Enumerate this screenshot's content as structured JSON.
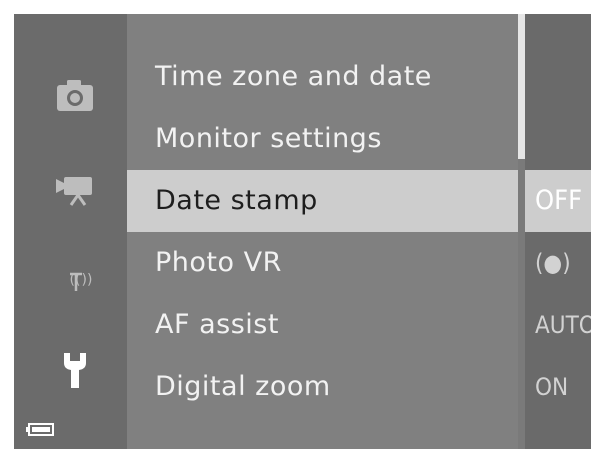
{
  "sidebar": {
    "icons": [
      "camera-icon",
      "movie-camera-icon",
      "wireless-icon",
      "wrench-icon"
    ]
  },
  "menu": {
    "items": [
      {
        "label": "Time zone and date",
        "value": ""
      },
      {
        "label": "Monitor settings",
        "value": ""
      },
      {
        "label": "Date stamp",
        "value": "OFF",
        "selected": true
      },
      {
        "label": "Photo VR",
        "value": "(●)"
      },
      {
        "label": "AF assist",
        "value": "AUTO"
      },
      {
        "label": "Digital zoom",
        "value": "ON"
      }
    ]
  },
  "status": {
    "battery_icon": "battery-icon"
  },
  "colors": {
    "background": "#707070",
    "menu_panel": "#808080",
    "selected_row": "#cdcdcd",
    "text": "#f2f2f2",
    "selected_text": "#1e1e1e"
  }
}
